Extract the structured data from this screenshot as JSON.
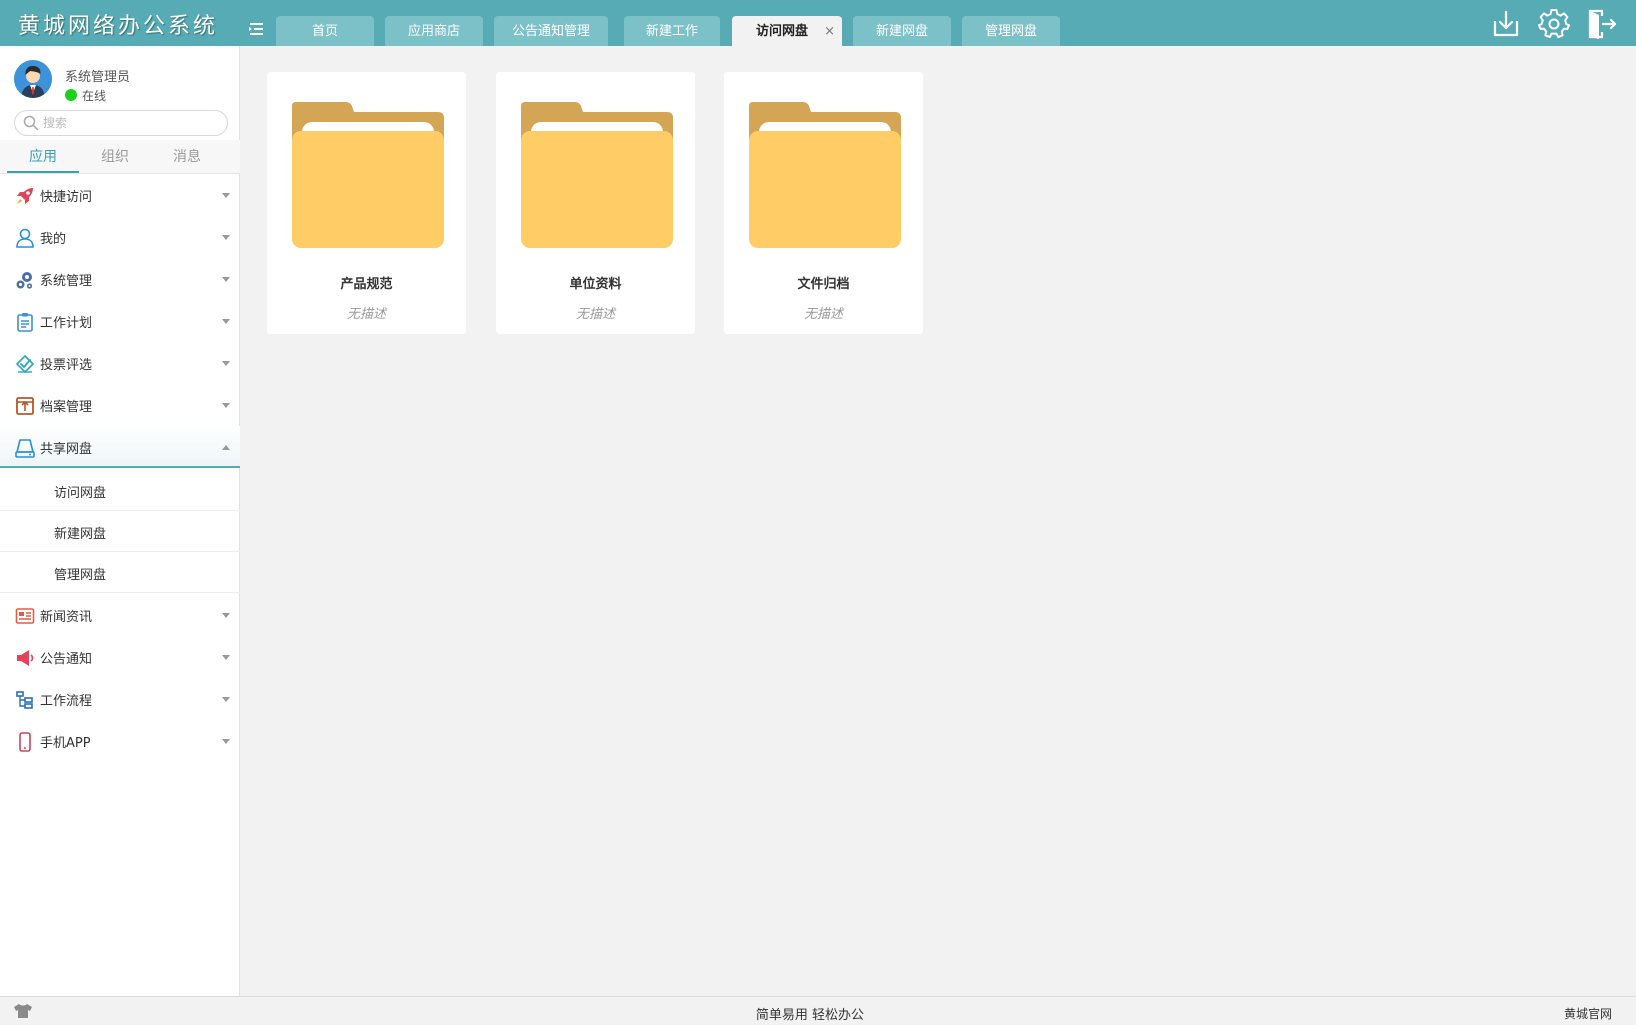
{
  "app": {
    "title": "黄城网络办公系统"
  },
  "header": {
    "tabs": [
      {
        "label": "首页"
      },
      {
        "label": "应用商店"
      },
      {
        "label": "公告通知管理"
      },
      {
        "label": "新建工作"
      },
      {
        "label": "访问网盘",
        "active": true,
        "close": "×"
      },
      {
        "label": "新建网盘"
      },
      {
        "label": "管理网盘"
      }
    ],
    "icons": [
      "menu-toggle-icon",
      "download-icon",
      "gear-icon",
      "logout-icon"
    ]
  },
  "user": {
    "name": "系统管理员",
    "status": "在线",
    "status_color": "#1cd11c"
  },
  "search": {
    "placeholder": "搜索",
    "value": ""
  },
  "sidebar_tabs": [
    {
      "label": "应用",
      "active": true
    },
    {
      "label": "组织"
    },
    {
      "label": "消息"
    }
  ],
  "nav": [
    {
      "label": "快捷访问",
      "icon": "rocket-icon"
    },
    {
      "label": "我的",
      "icon": "user-icon"
    },
    {
      "label": "系统管理",
      "icon": "gears-icon"
    },
    {
      "label": "工作计划",
      "icon": "clipboard-icon"
    },
    {
      "label": "投票评选",
      "icon": "vote-icon"
    },
    {
      "label": "档案管理",
      "icon": "archive-box-icon"
    },
    {
      "label": "共享网盘",
      "icon": "drive-icon",
      "expanded": true,
      "children": [
        "访问网盘",
        "新建网盘",
        "管理网盘"
      ]
    },
    {
      "label": "新闻资讯",
      "icon": "news-icon"
    },
    {
      "label": "公告通知",
      "icon": "megaphone-icon"
    },
    {
      "label": "工作流程",
      "icon": "flow-icon"
    },
    {
      "label": "手机APP",
      "icon": "phone-icon"
    }
  ],
  "folders": [
    {
      "title": "产品规范",
      "desc": "无描述"
    },
    {
      "title": "单位资料",
      "desc": "无描述"
    },
    {
      "title": "文件归档",
      "desc": "无描述"
    }
  ],
  "footer": {
    "slogan": "简单易用 轻松办公",
    "link": "黄城官网"
  },
  "colors": {
    "header": "#56abb5",
    "tab": "#7cc0c8",
    "accent": "#3aa0ad",
    "folder_front": "#ffcc66",
    "folder_back": "#d4a554"
  }
}
